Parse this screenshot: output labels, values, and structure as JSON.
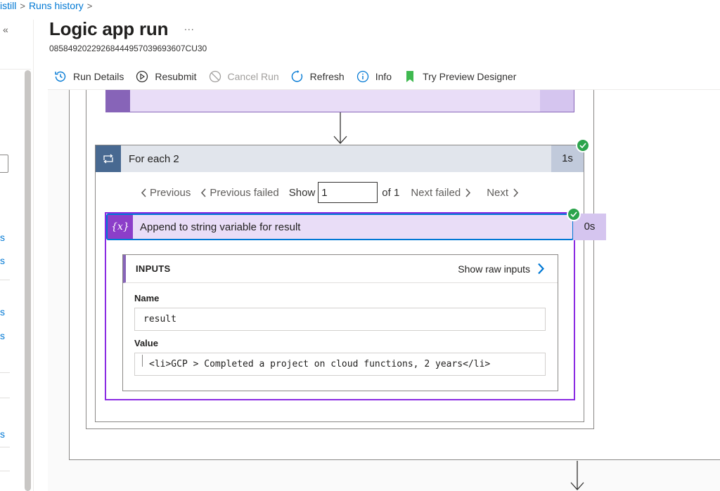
{
  "breadcrumb": {
    "items": [
      "istill",
      "Runs history"
    ],
    "separator": ">"
  },
  "sidebar": {
    "collapse_icon": "«",
    "letters": [
      "s",
      "s",
      "s",
      "s",
      "s"
    ]
  },
  "header": {
    "title": "Logic app run",
    "more": "...",
    "run_id": "08584920229268444957039693607CU30"
  },
  "toolbar": {
    "run_details": "Run Details",
    "resubmit": "Resubmit",
    "cancel_run": "Cancel Run",
    "refresh": "Refresh",
    "info": "Info",
    "try_preview": "Try Preview Designer"
  },
  "colors": {
    "accent": "#0078d4",
    "success": "#2ca44c",
    "foreach": "#486991",
    "variable": "#8c3ec9"
  },
  "foreach": {
    "title": "For each 2",
    "duration": "1s",
    "icon": "loop-icon"
  },
  "pager": {
    "previous": "Previous",
    "previous_failed": "Previous failed",
    "show": "Show",
    "current": "1",
    "of": "of 1",
    "next_failed": "Next failed",
    "next": "Next"
  },
  "action": {
    "title": "Append to string variable for result",
    "duration": "0s",
    "icon_text": "{x}",
    "inputs_label": "INPUTS",
    "show_raw": "Show raw inputs",
    "name_label": "Name",
    "name_value": "result",
    "value_label": "Value",
    "value_value": "<li>GCP > Completed a project on cloud functions, 2 years</li>"
  }
}
